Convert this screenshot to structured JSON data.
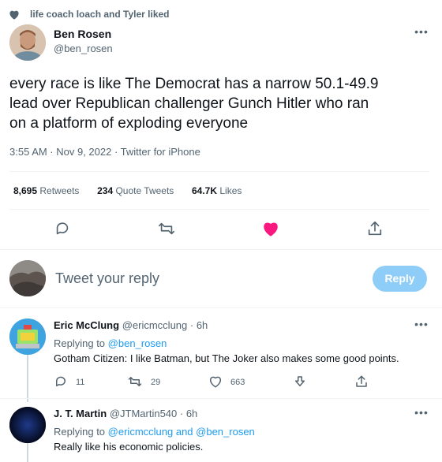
{
  "social_context": {
    "text": "life coach loach and Tyler liked"
  },
  "main_tweet": {
    "author_name": "Ben Rosen",
    "author_handle": "@ben_rosen",
    "text_line1": "every race is like The Democrat has a narrow 50.1-49.9",
    "text_line2": "lead over Republican challenger Gunch Hitler who ran",
    "text_line3": "on a platform of exploding everyone",
    "meta": "3:55 AM · Nov 9, 2022 · Twitter for iPhone",
    "stats": {
      "retweets_count": "8,695",
      "retweets_label": "Retweets",
      "quotes_count": "234",
      "quotes_label": "Quote Tweets",
      "likes_count": "64.7K",
      "likes_label": "Likes"
    },
    "liked": true
  },
  "reply_box": {
    "placeholder": "Tweet your reply",
    "button_label": "Reply"
  },
  "replies": [
    {
      "author_name": "Eric McClung",
      "author_handle": "@ericmcclung",
      "time": "· 6h",
      "replying_prefix": "Replying to",
      "replying_to": "@ben_rosen",
      "text": "Gotham Citizen: I like Batman, but The Joker also makes some good points.",
      "reply_count": "11",
      "retweet_count": "29",
      "like_count": "663"
    },
    {
      "author_name": "J. T. Martin",
      "author_handle": "@JTMartin540",
      "time": "· 6h",
      "replying_prefix": "Replying to",
      "replying_to": "@ericmcclung and @ben_rosen",
      "text": "Really like his economic policies."
    }
  ],
  "colors": {
    "accent": "#1d9bf0",
    "like": "#f91880",
    "muted": "#536471",
    "reply_button": "#8ecdf8"
  },
  "icons": [
    "heart-icon",
    "more-icon",
    "reply-icon",
    "retweet-icon",
    "share-icon",
    "downvote-icon"
  ]
}
